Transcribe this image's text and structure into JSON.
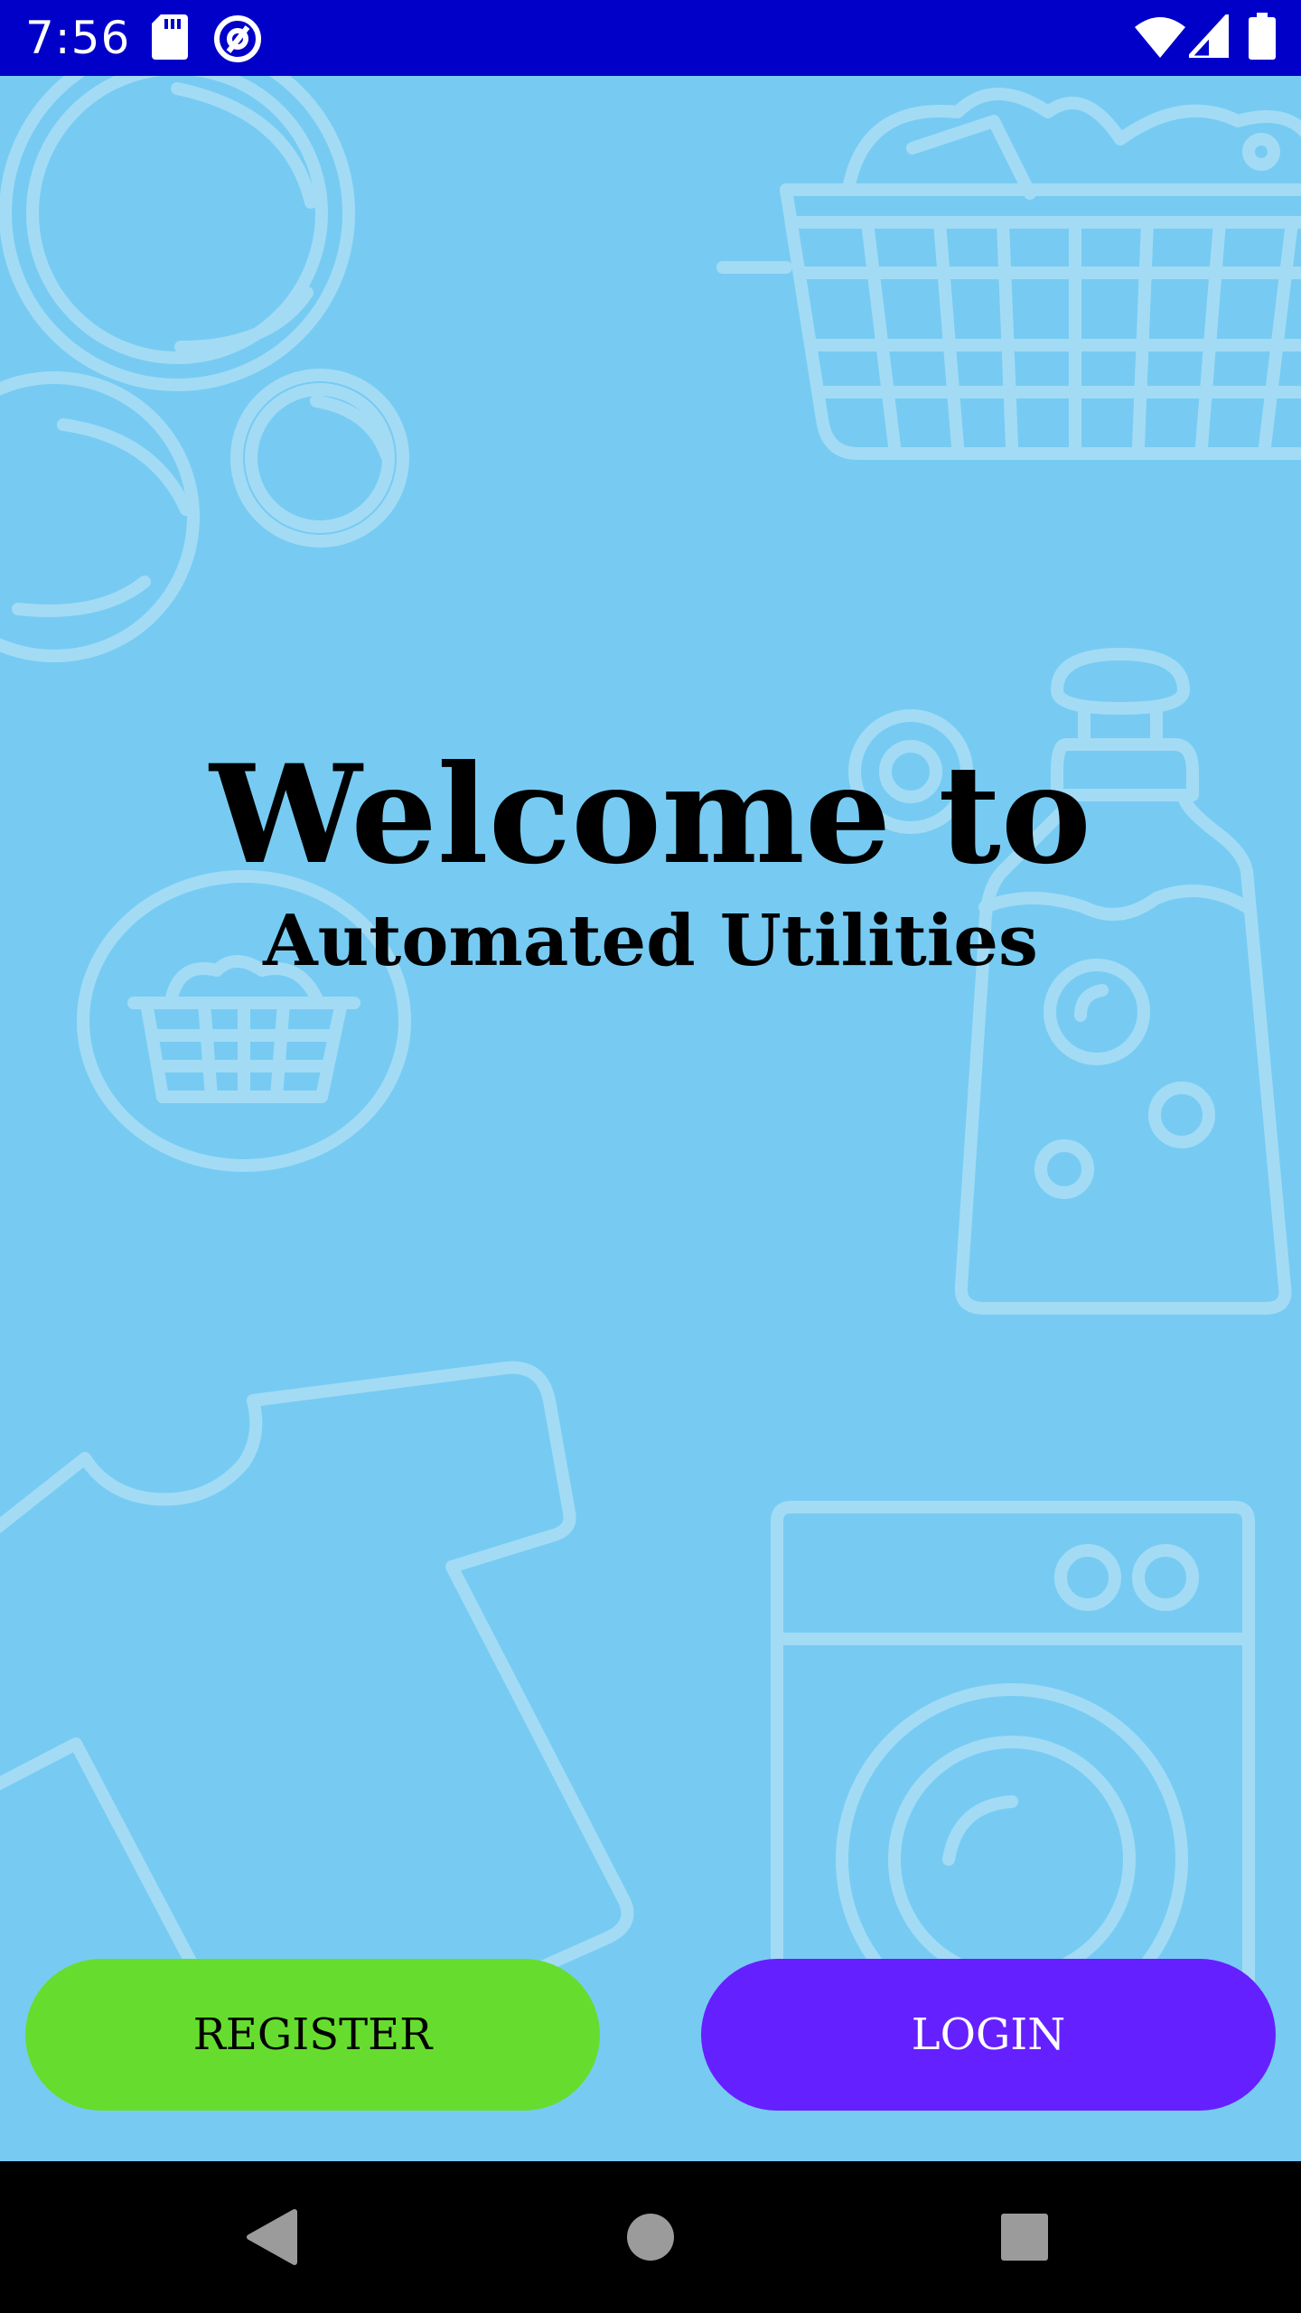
{
  "status_bar": {
    "time": "7:56",
    "background": "#0000c8",
    "icons": [
      "sd-card-icon",
      "at-sign-icon",
      "wifi-icon",
      "cell-signal-icon",
      "battery-icon"
    ]
  },
  "main": {
    "background": "#77cbf2",
    "decor_icons": [
      "bubble-icon",
      "laundry-basket-icon",
      "detergent-bottle-icon",
      "t-shirt-icon",
      "washing-machine-icon"
    ],
    "title": "Welcome to",
    "subtitle": "Automated Utilities"
  },
  "buttons": {
    "register_label": "REGISTER",
    "register_color": "#66dd2e",
    "login_label": "LOGIN",
    "login_color": "#6520ff"
  },
  "nav_bar": {
    "icons": [
      "back-icon",
      "home-icon",
      "recents-icon"
    ]
  }
}
